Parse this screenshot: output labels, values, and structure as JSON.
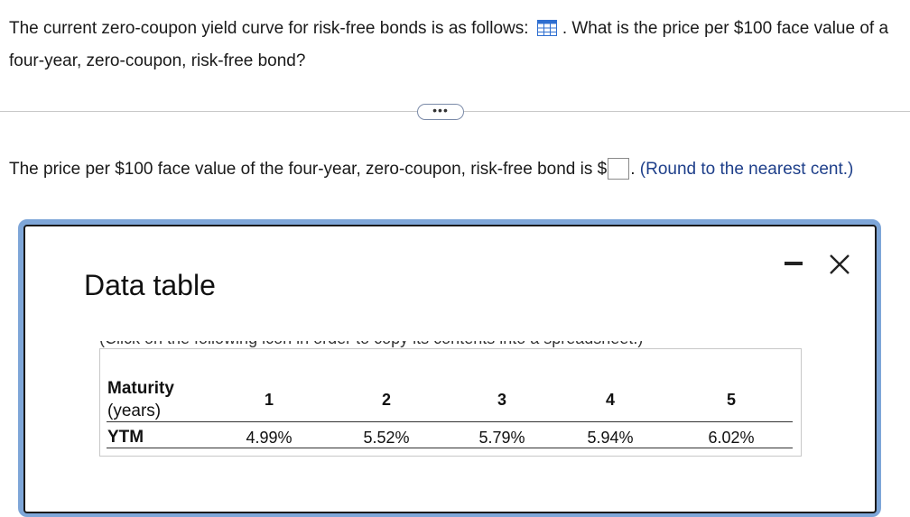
{
  "question": {
    "text_before_icon": "The current zero-coupon yield curve for risk-free bonds is as follows:",
    "table_icon": "spreadsheet-grid-icon",
    "text_after_icon": ". What is the price per $100 face value of a four-year, zero-coupon, risk-free bond?"
  },
  "more_button": "•••",
  "answer": {
    "prefix": "The price per $100 face value of the four-year, zero-coupon, risk-free bond is $",
    "input_value": "",
    "suffix": ".",
    "hint": "(Round to the nearest cent.)"
  },
  "dialog": {
    "title": "Data table",
    "minimize_icon": "minimize-icon",
    "close_icon": "close-icon",
    "note_clipped": "(Click on the following icon   in order to copy its contents into a spreadsheet.)",
    "table": {
      "maturity_label_line1": "Maturity",
      "maturity_label_line2": "(years)",
      "ytm_label": "YTM",
      "maturities": [
        "1",
        "2",
        "3",
        "4",
        "5"
      ],
      "yields": [
        "4.99%",
        "5.52%",
        "5.79%",
        "5.94%",
        "6.02%"
      ]
    }
  },
  "colors": {
    "dialog_frame": "#7ea6d8",
    "hint_text": "#1e3f8a",
    "icon_blue": "#2f6fd0"
  }
}
